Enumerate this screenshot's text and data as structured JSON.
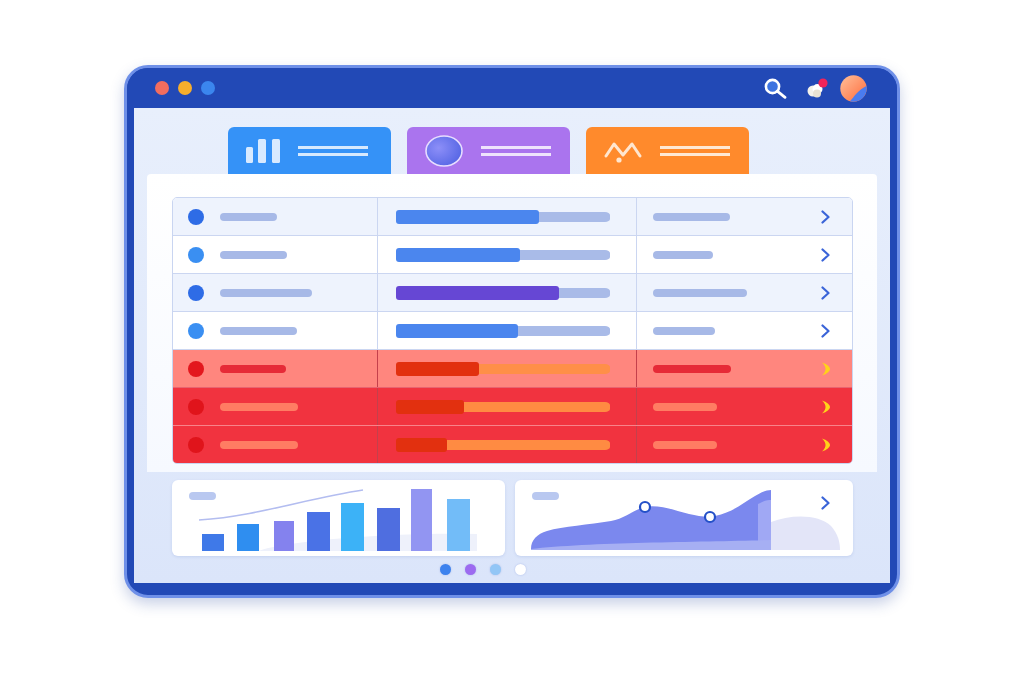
{
  "window": {
    "controls": [
      {
        "color": "#f26d5f"
      },
      {
        "color": "#f6ae2d"
      },
      {
        "color": "#3b86ee"
      }
    ],
    "notification_badge": true
  },
  "tabs": [
    {
      "kind": "bars",
      "color": "#3592f7"
    },
    {
      "kind": "orb",
      "color": "#aa74ee"
    },
    {
      "kind": "wave",
      "color": "#ff8a2c"
    }
  ],
  "table": {
    "rows": [
      {
        "kind": "normal",
        "status": {
          "color": "#2e6ce6"
        },
        "progress": {
          "level": 0.67,
          "color": "#4b86ee"
        }
      },
      {
        "kind": "normal",
        "status": {
          "color": "#3a8ff2"
        },
        "progress": {
          "level": 0.58,
          "color": "#4b86ee"
        }
      },
      {
        "kind": "normal",
        "status": {
          "color": "#2e6ce6"
        },
        "progress": {
          "level": 0.76,
          "color": "#6647d4"
        }
      },
      {
        "kind": "normal",
        "status": {
          "color": "#3a8ff2"
        },
        "progress": {
          "level": 0.57,
          "color": "#4b86ee"
        }
      },
      {
        "kind": "warning",
        "status": {
          "color": "#e3171d"
        },
        "progress": {
          "level": 0.39,
          "color": "#e2300f"
        }
      },
      {
        "kind": "critical",
        "status": {
          "color": "#e0141b"
        },
        "progress": {
          "level": 0.32,
          "color": "#e2300f"
        }
      },
      {
        "kind": "critical",
        "status": {
          "color": "#e0141b"
        },
        "progress": {
          "level": 0.24,
          "color": "#e2300f"
        }
      }
    ]
  },
  "charts": [
    {
      "kind": "bar",
      "has_chevron": false
    },
    {
      "kind": "area",
      "has_chevron": true
    }
  ],
  "pager": {
    "dots": [
      {
        "color": "#3d82ee"
      },
      {
        "color": "#9c6bf0"
      },
      {
        "color": "#92c6f6"
      },
      {
        "color": "#ffffff"
      }
    ]
  }
}
